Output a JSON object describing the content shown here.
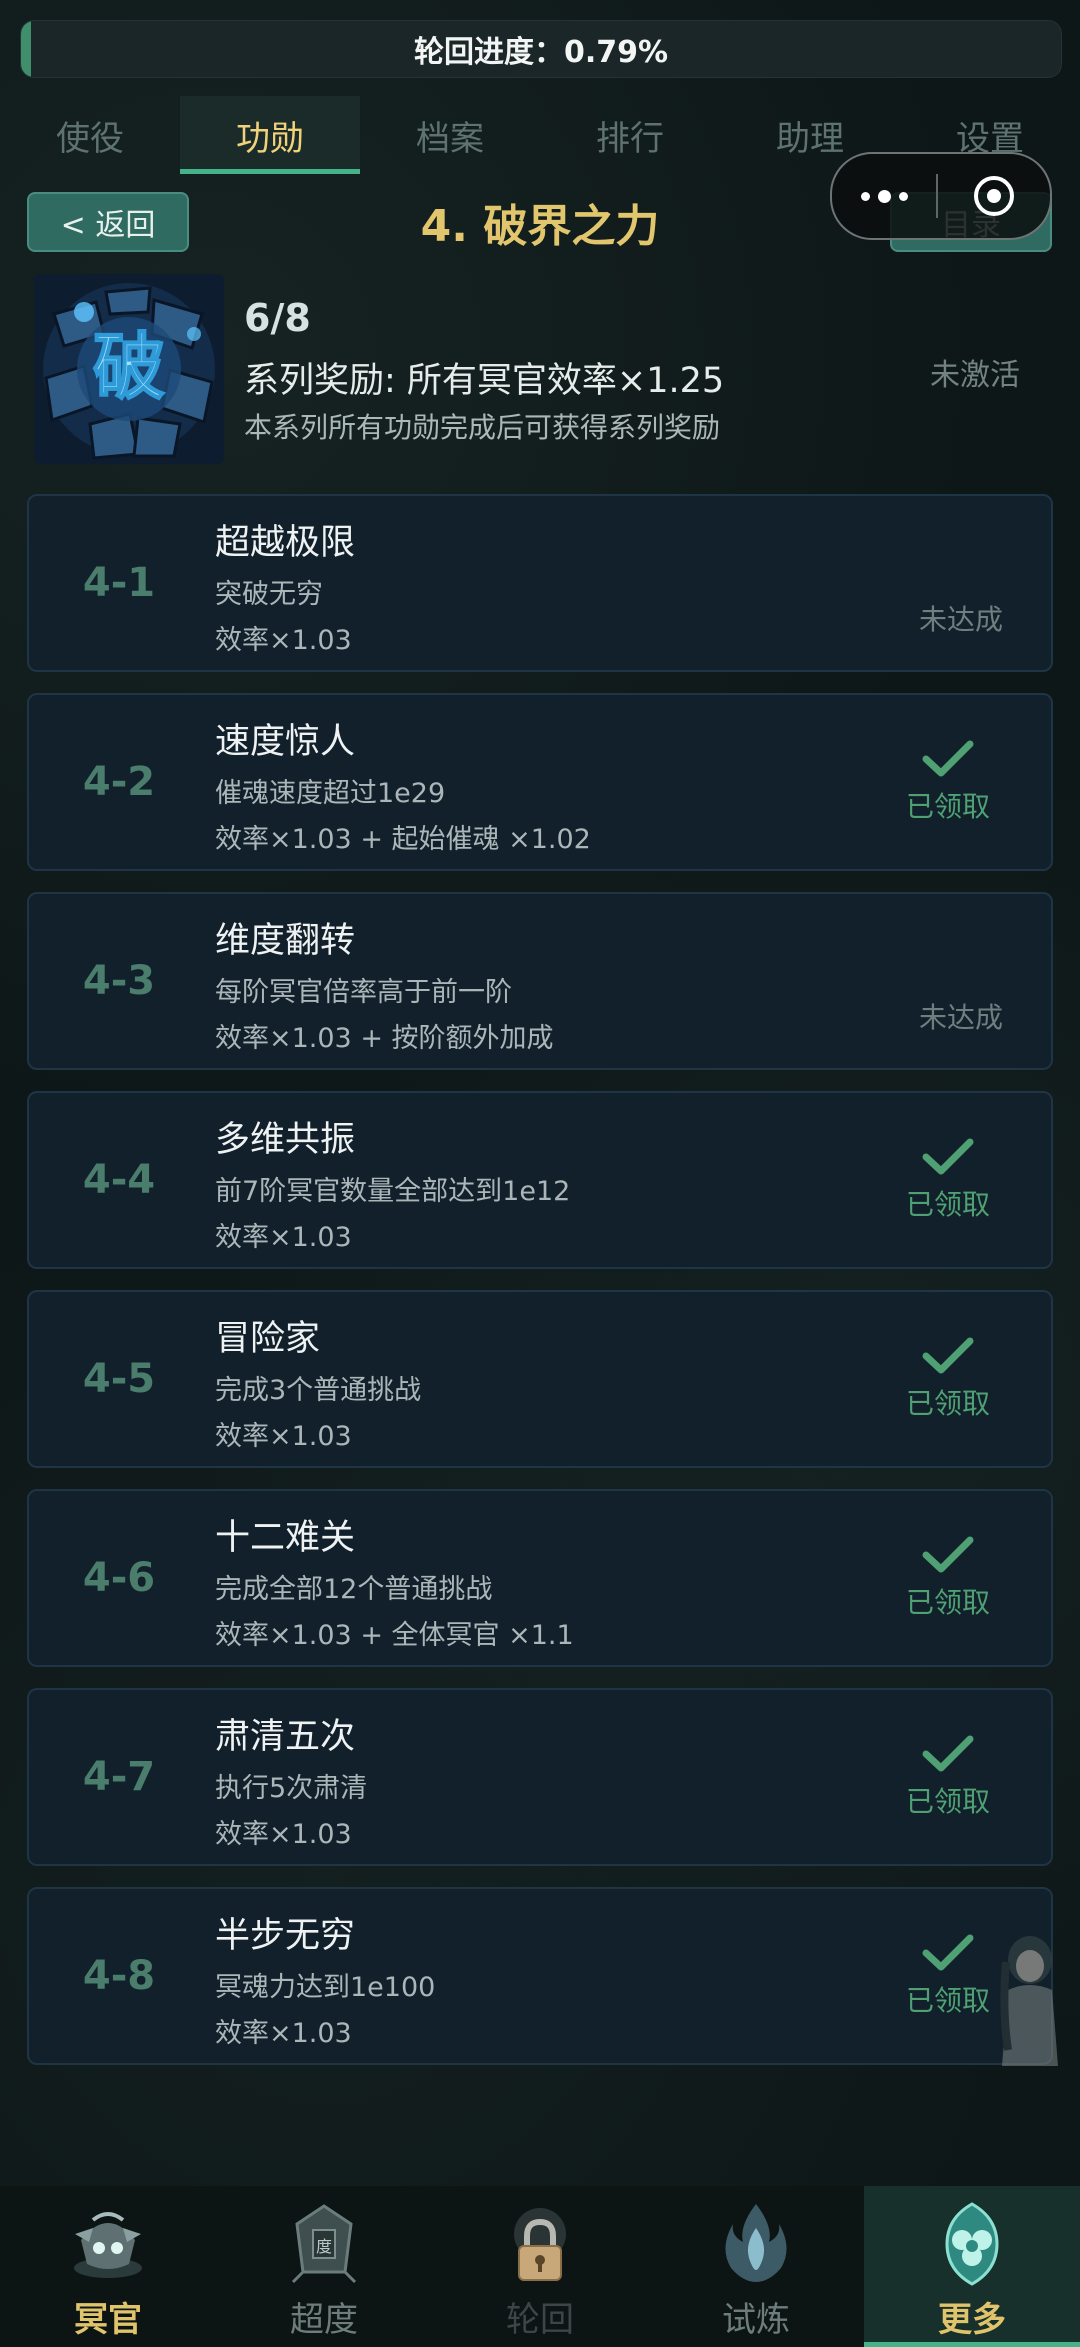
{
  "progress": {
    "label": "轮回进度：0.79%",
    "fraction": 0.0079
  },
  "tabs": [
    {
      "label": "使役",
      "active": false
    },
    {
      "label": "功勋",
      "active": true
    },
    {
      "label": "档案",
      "active": false
    },
    {
      "label": "排行",
      "active": false
    },
    {
      "label": "助理",
      "active": false
    },
    {
      "label": "设置",
      "active": false
    }
  ],
  "header": {
    "back_label": "< 返回",
    "title": "4. 破界之力",
    "toc_label": "目录"
  },
  "series": {
    "icon_glyph": "破",
    "count": "6/8",
    "reward": "系列奖励: 所有冥官效率×1.25",
    "description": "本系列所有功勋完成后可获得系列奖励",
    "status": "未激活"
  },
  "achievements": [
    {
      "id": "4-1",
      "title": "超越极限",
      "desc": "突破无穷",
      "reward": "效率×1.03",
      "claimed": false,
      "status": "未达成"
    },
    {
      "id": "4-2",
      "title": "速度惊人",
      "desc": "催魂速度超过1e29",
      "reward": "效率×1.03 + 起始催魂 ×1.02",
      "claimed": true,
      "status": "已领取"
    },
    {
      "id": "4-3",
      "title": "维度翻转",
      "desc": "每阶冥官倍率高于前一阶",
      "reward": "效率×1.03 + 按阶额外加成",
      "claimed": false,
      "status": "未达成"
    },
    {
      "id": "4-4",
      "title": "多维共振",
      "desc": "前7阶冥官数量全部达到1e12",
      "reward": "效率×1.03",
      "claimed": true,
      "status": "已领取"
    },
    {
      "id": "4-5",
      "title": "冒险家",
      "desc": "完成3个普通挑战",
      "reward": "效率×1.03",
      "claimed": true,
      "status": "已领取"
    },
    {
      "id": "4-6",
      "title": "十二难关",
      "desc": "完成全部12个普通挑战",
      "reward": "效率×1.03 + 全体冥官 ×1.1",
      "claimed": true,
      "status": "已领取"
    },
    {
      "id": "4-7",
      "title": "肃清五次",
      "desc": "执行5次肃清",
      "reward": "效率×1.03",
      "claimed": true,
      "status": "已领取"
    },
    {
      "id": "4-8",
      "title": "半步无穷",
      "desc": "冥魂力达到1e100",
      "reward": "效率×1.03",
      "claimed": true,
      "status": "已领取"
    }
  ],
  "bottom_nav": [
    {
      "label": "冥官",
      "icon": "ghost-officer-icon",
      "active": false,
      "color": "#e0c46c"
    },
    {
      "label": "超度",
      "icon": "shrine-icon",
      "active": false,
      "color": "#6d7d7a"
    },
    {
      "label": "轮回",
      "icon": "lock-icon",
      "active": false,
      "color": "#3b4746",
      "locked": true
    },
    {
      "label": "试炼",
      "icon": "flame-icon",
      "active": false,
      "color": "#6d7d7a"
    },
    {
      "label": "更多",
      "icon": "more-emblem-icon",
      "active": true,
      "color": "#e0c46c"
    }
  ],
  "colors": {
    "accent": "#44b38a",
    "title_gold": "#e2c66e",
    "claimed_green": "#4fa073"
  }
}
